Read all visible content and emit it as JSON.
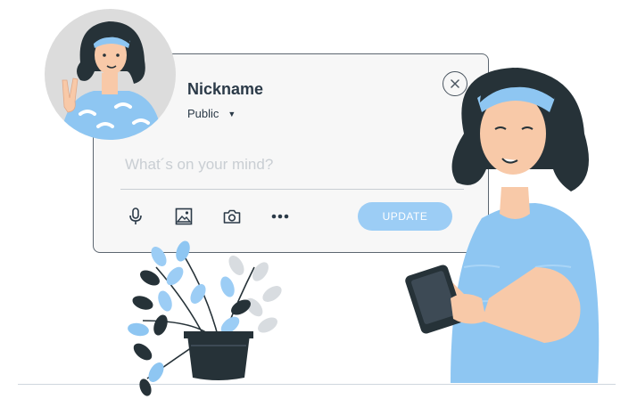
{
  "composer": {
    "nickname": "Nickname",
    "privacy": "Public",
    "placeholder": "What´s on your mind?",
    "update_label": "UPDATE"
  },
  "icons": [
    "microphone-icon",
    "image-icon",
    "camera-icon",
    "more-icon",
    "close-icon",
    "caret-down-icon"
  ],
  "colors": {
    "accent": "#9ccdf5",
    "text": "#2b3a48",
    "placeholder": "#c9ced3",
    "shirt": "#8ec6f2",
    "hair": "#263238"
  }
}
